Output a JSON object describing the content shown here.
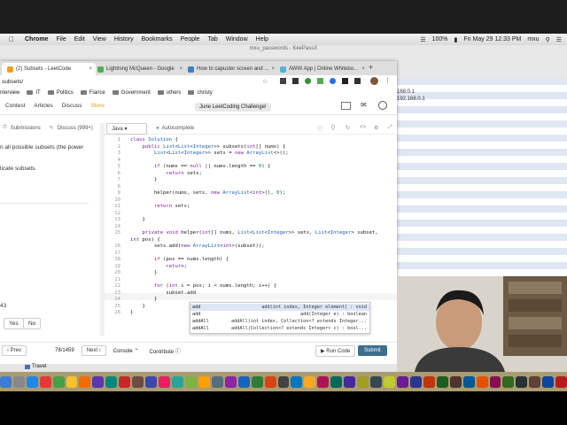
{
  "menubar": {
    "app": "Chrome",
    "items": [
      "File",
      "Edit",
      "View",
      "History",
      "Bookmarks",
      "People",
      "Tab",
      "Window",
      "Help"
    ],
    "battery": "100%",
    "clock": "Fri May 29  12:33 PM",
    "user": "mxu"
  },
  "keepass": {
    "title": "mxu_passwords - KeePassX",
    "ip_lines": [
      "168.0.1",
      "192.168.0.1"
    ],
    "bottom_item": "Travel"
  },
  "tabs": [
    {
      "label": "(2) Subsets - LeetCode",
      "color": "#f0a020",
      "active": true
    },
    {
      "label": "Lightning McQueen - Google",
      "color": "#4caf50",
      "active": false
    },
    {
      "label": "How to capuster screen and ...",
      "color": "#3f7fbf",
      "active": false
    },
    {
      "label": "AWW App | Online Whitebo...",
      "color": "#55b0d6",
      "active": false
    }
  ],
  "url": "subsets/",
  "bookmarks": [
    "nterview",
    "IT",
    "Politics",
    "Fiance",
    "Government",
    "others",
    "christy"
  ],
  "leetcode": {
    "nav": [
      "Contest",
      "Articles",
      "Discuss",
      "Store"
    ],
    "challenge": "June LeetCoding Challenge!",
    "subtabs": [
      "Submissions",
      "Discuss (999+)"
    ],
    "desc_lines": [
      "n all possible subsets (the power",
      "licate subsets."
    ],
    "count": "43",
    "yes": "Yes",
    "no": "No",
    "language": "Java",
    "autocomplete": "Autocomplete",
    "prev": "Prev",
    "page": "78/1459",
    "next": "Next",
    "console": "Console",
    "contribute": "Contribute",
    "run": "Run Code",
    "submit": "Submit"
  },
  "code": {
    "line_numbers": [
      "1",
      "2",
      "3",
      "4",
      "5",
      "6",
      "7",
      "8",
      "9",
      "10",
      "11",
      "12",
      "13",
      "14",
      "15",
      "",
      "16",
      "17",
      "18",
      "19",
      "20",
      "21",
      "22",
      "23",
      "24",
      "25",
      "26"
    ],
    "lines": [
      "class Solution {",
      "    public List<List<Integer>> subsets(int[] nums) {",
      "        List<List<Integer>> sets = new ArrayList<>();",
      "",
      "        if (nums == null || nums.length == 0) {",
      "            return sets;",
      "        }",
      "",
      "        helper(nums, sets, new ArrayList<int>(), 0);",
      "",
      "        return sets;",
      "",
      "    }",
      "",
      "    private void helper(int[] nums, List<List<Integer>> sets, List<Integer> subset,",
      "int pos) {",
      "        sets.add(new ArrayList<int>(subset));",
      "",
      "        if (pos == nums.length) {",
      "            return;",
      "        }",
      "",
      "        for (int i = pos; i < nums.length; i++) {",
      "            subset.add",
      "        }",
      "    }",
      "}"
    ]
  },
  "autocomplete_items": [
    {
      "name": "add",
      "sig": "add(int index, Integer element) : void"
    },
    {
      "name": "add",
      "sig": "add(Integer e) : boolean"
    },
    {
      "name": "addAll",
      "sig": "addAll(int index, Collection<? extends Integer..."
    },
    {
      "name": "addAll",
      "sig": "addAll(Collection<? extends Integer> c) : bool..."
    }
  ]
}
